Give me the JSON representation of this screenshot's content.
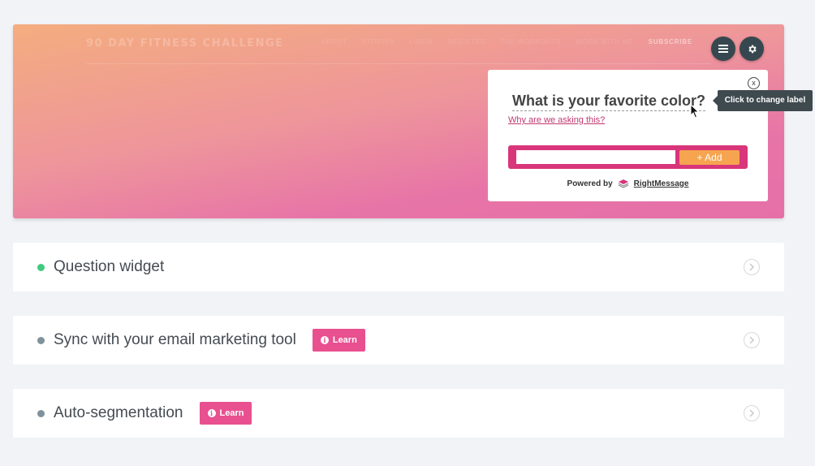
{
  "hero": {
    "site_title": "90 DAY FITNESS CHALLENGE",
    "nav": [
      "ABOUT",
      "STORIES",
      "LOGIN",
      "REGISTER",
      "THE WORKOUTS",
      "WORK WITH ME"
    ],
    "nav_subscribe": "SUBSCRIBE",
    "menu_icon": "hamburger-menu-icon",
    "settings_icon": "gear-icon"
  },
  "widget": {
    "close_label": "x",
    "question": "What is your favorite color?",
    "why_link": "Why are we asking this?",
    "input_value": "",
    "add_button": "+ Add",
    "powered_by": "Powered by",
    "brand": "RightMessage"
  },
  "tooltip": {
    "text": "Click to change label"
  },
  "cards": [
    {
      "label": "Question widget",
      "status_color": "#3fcb7f",
      "learn": ""
    },
    {
      "label": "Sync with your email marketing tool",
      "status_color": "#7f929c",
      "learn": "Learn"
    },
    {
      "label": "Auto-segmentation",
      "status_color": "#7f929c",
      "learn": "Learn"
    }
  ],
  "colors": {
    "accent_pink": "#e8508f",
    "form_bg": "#d8357a",
    "add_button": "#f6a44f",
    "dark_button": "#37474f"
  }
}
